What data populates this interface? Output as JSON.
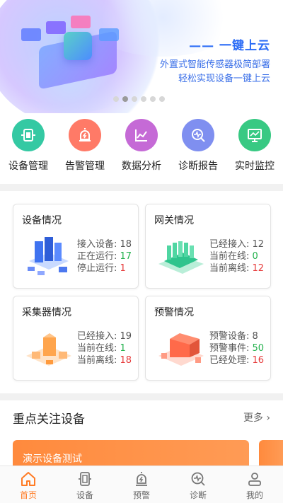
{
  "banner": {
    "title": "—— 一键上云",
    "line1": "外置式智能传感器极简部署",
    "line2": "轻松实现设备一键上云",
    "dots": 6,
    "active_dot": 1
  },
  "menu": [
    {
      "label": "设备管理",
      "icon": "device-icon",
      "color": "#34c9a3"
    },
    {
      "label": "告警管理",
      "icon": "alarm-icon",
      "color": "#ff7a67"
    },
    {
      "label": "数据分析",
      "icon": "chart-icon",
      "color": "#c56ad6"
    },
    {
      "label": "诊断报告",
      "icon": "diagnosis-icon",
      "color": "#7f8ff0"
    },
    {
      "label": "实时监控",
      "icon": "monitor-icon",
      "color": "#38c983"
    }
  ],
  "cards": {
    "device": {
      "title": "设备情况",
      "stats": [
        {
          "label": "接入设备: ",
          "value": "18"
        },
        {
          "label": "正在运行: ",
          "value": "17"
        },
        {
          "label": "停止运行: ",
          "value": "1"
        }
      ]
    },
    "gateway": {
      "title": "网关情况",
      "stats": [
        {
          "label": "已经接入: ",
          "value": "12"
        },
        {
          "label": "当前在线: ",
          "value": "0"
        },
        {
          "label": "当前离线: ",
          "value": "12"
        }
      ]
    },
    "collector": {
      "title": "采集器情况",
      "stats": [
        {
          "label": "已经接入: ",
          "value": "19"
        },
        {
          "label": "当前在线: ",
          "value": "1"
        },
        {
          "label": "当前离线: ",
          "value": "18"
        }
      ]
    },
    "warning": {
      "title": "预警情况",
      "stats": [
        {
          "label": "预警设备: ",
          "value": "8"
        },
        {
          "label": "预警事件: ",
          "value": "50"
        },
        {
          "label": "已经处理: ",
          "value": "16"
        }
      ]
    }
  },
  "focus": {
    "title": "重点关注设备",
    "more": "更多",
    "demo_label": "演示设备测试"
  },
  "tabbar": [
    {
      "label": "首页",
      "icon": "home-icon",
      "active": true
    },
    {
      "label": "设备",
      "icon": "device-icon",
      "active": false
    },
    {
      "label": "预警",
      "icon": "warning-icon",
      "active": false
    },
    {
      "label": "诊断",
      "icon": "diagnosis-icon",
      "active": false
    },
    {
      "label": "我的",
      "icon": "user-icon",
      "active": false
    }
  ],
  "colors": {
    "accent": "#ff7b24",
    "green": "#23b14d",
    "red": "#e63b3b",
    "banner_text": "#2b6cf6"
  }
}
